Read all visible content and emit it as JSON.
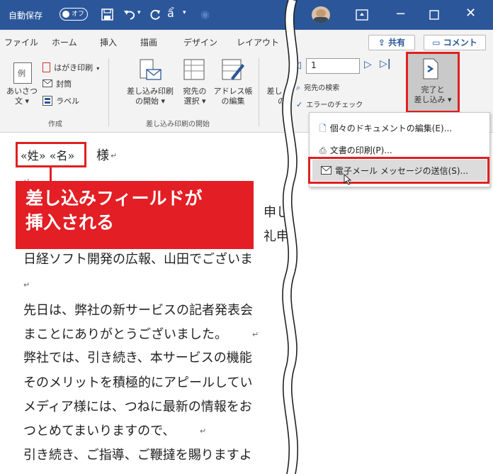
{
  "titlebar": {
    "autosave_label": "自動保存",
    "toggle_state": "オフ",
    "undo_icon": "undo-icon",
    "redo_icon": "redo-icon"
  },
  "tabs": [
    "ファイル",
    "ホーム",
    "挿入",
    "描画",
    "デザイン",
    "レイアウト"
  ],
  "share_button": "共有",
  "comment_button": "コメント",
  "ribbon": {
    "create_group": {
      "label": "作成",
      "greeting_line1": "あいさつ",
      "greeting_line2": "文",
      "postcard": "はがき印刷",
      "envelope": "封筒",
      "labels": "ラベル",
      "example": "例"
    },
    "start_merge_group": {
      "label": "差し込み印刷の開始",
      "start_merge_line1": "差し込み印刷",
      "start_merge_line2": "の開始",
      "select_recipients_line1": "宛先の",
      "select_recipients_line2": "選択",
      "edit_address_line1": "アドレス帳",
      "edit_address_line2": "の編集"
    },
    "partial_btn_line1": "差し",
    "partial_btn_line2": "の",
    "preview_group": {
      "record_number": "1",
      "find_recipient": "宛先の検索",
      "check_errors": "エラーのチェック"
    },
    "finish_merge_line1": "完了と",
    "finish_merge_line2": "差し込み"
  },
  "dropdown": {
    "items": [
      "個々のドキュメントの編集(E)...",
      "文書の印刷(P)...",
      "電子メール メッセージの送信(S)..."
    ]
  },
  "document": {
    "field_surname": "«姓»",
    "field_name": "«名»",
    "honorific": "様",
    "lines": [
      "申し",
      "礼申",
      "日経ソフト開発の広報、山田でございま",
      "",
      "先日は、弊社の新サービスの記者発表会",
      "まことにありがとうございました。",
      "弊社では、引き続き、本サービスの機能",
      "そのメリットを積極的にアピールしてい",
      "メディア様には、つねに最新の情報をお",
      "つとめてまいりますので、",
      "引き続き、ご指導、ご鞭撻を賜りますよ"
    ]
  },
  "callout": {
    "line1": "差し込みフィールドが",
    "line2": "挿入される"
  },
  "colors": {
    "titlebar": "#2b579a",
    "ribbon": "#f3f3f3",
    "highlight_red": "#e02020",
    "callout_red": "#e31e24"
  }
}
